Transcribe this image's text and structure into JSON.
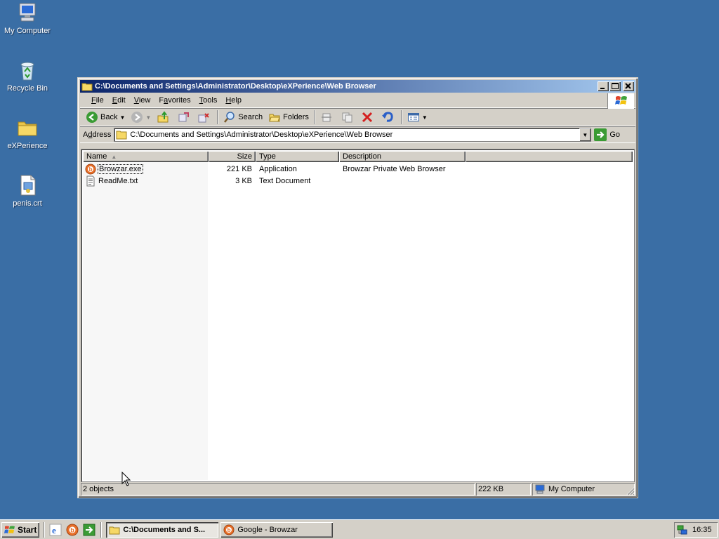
{
  "desktop": {
    "icons": [
      {
        "label": "My Computer",
        "icon": "computer-icon"
      },
      {
        "label": "Recycle Bin",
        "icon": "recycle-bin-icon"
      },
      {
        "label": "eXPerience",
        "icon": "folder-icon"
      },
      {
        "label": "penis.crt",
        "icon": "certificate-file-icon"
      }
    ]
  },
  "window": {
    "title": "C:\\Documents and Settings\\Administrator\\Desktop\\eXPerience\\Web Browser",
    "menu": [
      {
        "label": "File",
        "underline": "F",
        "rest": "ile"
      },
      {
        "label": "Edit",
        "underline": "E",
        "rest": "dit"
      },
      {
        "label": "View",
        "underline": "V",
        "rest": "iew"
      },
      {
        "label": "Favorites",
        "underline": "a",
        "pre": "F",
        "rest": "vorites"
      },
      {
        "label": "Tools",
        "underline": "T",
        "rest": "ools"
      },
      {
        "label": "Help",
        "underline": "H",
        "rest": "elp"
      }
    ],
    "menu_labels": {
      "file_u": "F",
      "file_r": "ile",
      "edit_u": "E",
      "edit_r": "dit",
      "view_u": "V",
      "view_r": "iew",
      "fav_p": "F",
      "fav_u": "a",
      "fav_r": "vorites",
      "tools_u": "T",
      "tools_r": "ools",
      "help_u": "H",
      "help_r": "elp"
    },
    "toolbar": {
      "back": "Back",
      "search": "Search",
      "folders": "Folders"
    },
    "address": {
      "label_u": "d",
      "label_pre": "A",
      "label_rest": "dress",
      "value": "C:\\Documents and Settings\\Administrator\\Desktop\\eXPerience\\Web Browser",
      "go": "Go"
    },
    "columns": {
      "name": "Name",
      "size": "Size",
      "type": "Type",
      "description": "Description"
    },
    "files": [
      {
        "name": "Browzar.exe",
        "size": "221 KB",
        "type": "Application",
        "description": "Browzar Private Web Browser",
        "icon": "browzar-icon"
      },
      {
        "name": "ReadMe.txt",
        "size": "3 KB",
        "type": "Text Document",
        "description": "",
        "icon": "text-document-icon"
      }
    ],
    "status": {
      "objects": "2 objects",
      "size": "222 KB",
      "zone": "My Computer"
    }
  },
  "taskbar": {
    "start": "Start",
    "tasks": [
      {
        "label": "C:\\Documents and S...",
        "active": true
      },
      {
        "label": "Google - Browzar",
        "active": false
      }
    ],
    "clock": "16:35"
  },
  "colors": {
    "desktop": "#3a6ea5",
    "title_start": "#0a246a",
    "title_end": "#a6caf0",
    "face": "#d4d0c8"
  }
}
